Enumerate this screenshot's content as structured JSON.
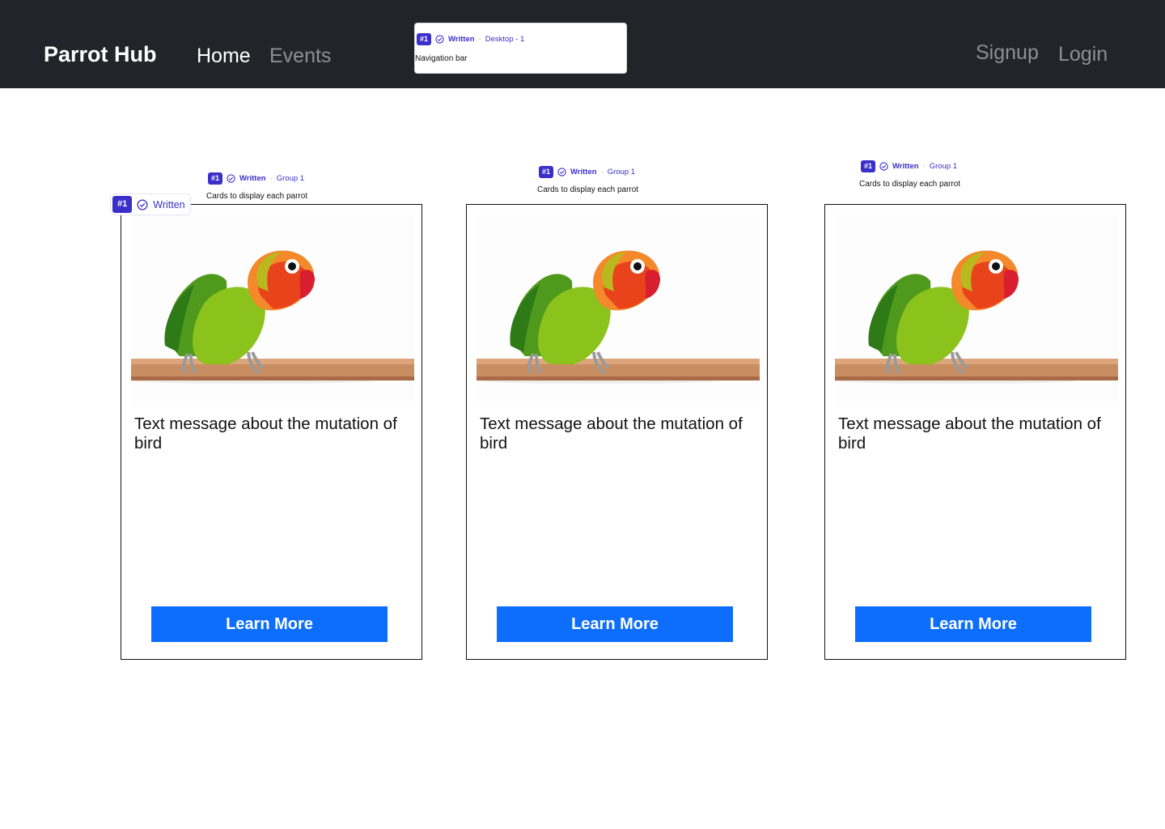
{
  "navbar": {
    "brand": "Parrot Hub",
    "links": [
      {
        "label": "Home",
        "active": true
      },
      {
        "label": "Events",
        "active": false
      }
    ],
    "auth": {
      "signup": "Signup",
      "login": "Login"
    }
  },
  "annotations": {
    "tag": "#1",
    "status": "Written",
    "separator": "·",
    "nav_frame": "Desktop - 1",
    "nav_description": "Navigation bar",
    "card_frame": "Group 1",
    "card_description": "Cards to display each parrot"
  },
  "cards": [
    {
      "text": "Text message about the mutation of bird",
      "button": "Learn More",
      "image": "parrot-photo"
    },
    {
      "text": "Text message about the mutation of bird",
      "button": "Learn More",
      "image": "parrot-photo"
    },
    {
      "text": "Text message about the mutation of bird",
      "button": "Learn More",
      "image": "parrot-photo"
    }
  ],
  "colors": {
    "navbar_bg": "#212529",
    "nav_active": "#ffffff",
    "nav_muted": "#8c8f93",
    "button_bg": "#0d6efd",
    "annotation_accent": "#3b2fc9"
  },
  "icons": [
    "check-circle-icon"
  ]
}
